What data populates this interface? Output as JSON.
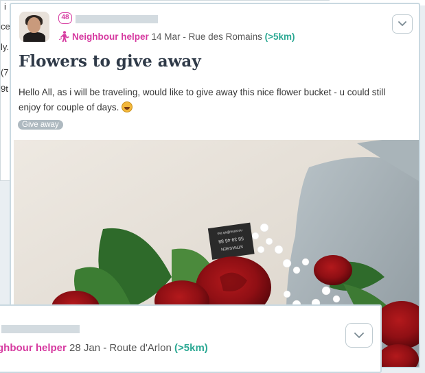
{
  "background_card": {
    "lines": [
      "i",
      "ce",
      "ly.",
      "(7",
      "9t"
    ]
  },
  "post": {
    "badge_count": "48",
    "role": "Neighbour helper",
    "date": "14 Mar",
    "location_sep": " - ",
    "location": "Rue des Romains",
    "distance": "(>5km)",
    "title": "Flowers to give away",
    "description": "Hello All, as i will be traveling, would like to give away this nice flower bucket - u could still enjoy for couple of days.",
    "tag": "Give away",
    "photo_card_text": [
      "nozama@eb.tno",
      "58 39 46 88",
      "STRASSEN"
    ]
  },
  "post2": {
    "role": "ghbour helper",
    "date": "28 Jan",
    "location_sep": " - ",
    "location": "Route d'Arlon",
    "distance": "(>5km)"
  }
}
